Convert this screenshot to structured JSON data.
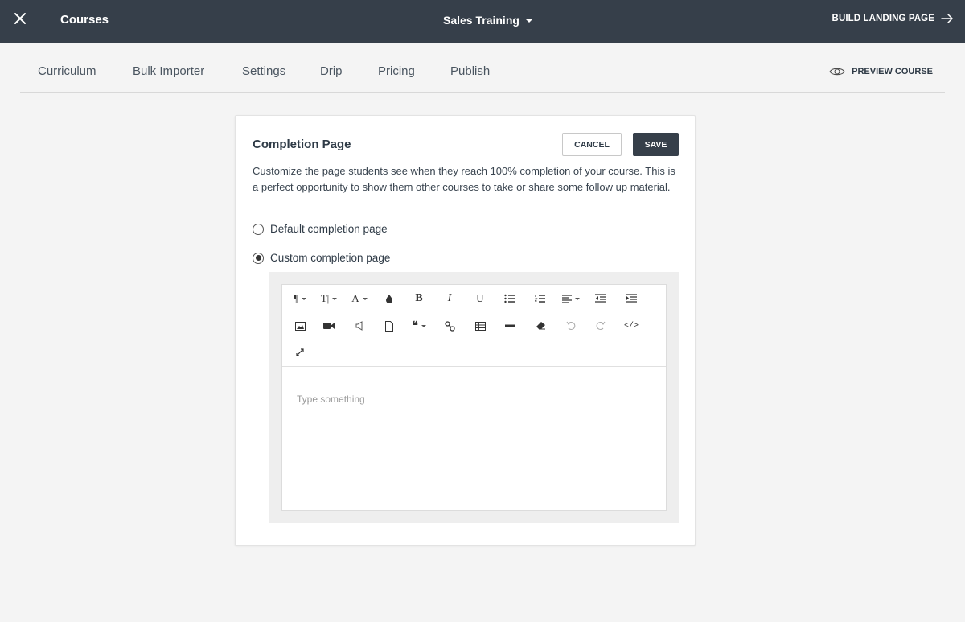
{
  "topbar": {
    "title": "Courses",
    "course_name": "Sales Training",
    "build_label": "BUILD LANDING PAGE"
  },
  "tabs": [
    {
      "label": "Curriculum"
    },
    {
      "label": "Bulk Importer"
    },
    {
      "label": "Settings"
    },
    {
      "label": "Drip"
    },
    {
      "label": "Pricing"
    },
    {
      "label": "Publish"
    }
  ],
  "preview_label": "PREVIEW COURSE",
  "card": {
    "heading": "Completion Page",
    "cancel_label": "CANCEL",
    "save_label": "SAVE",
    "description": "Customize the page students see when they reach 100% completion of your course. This is a perfect opportunity to show them other courses to take or share some follow up material.",
    "options": [
      {
        "label": "Default completion page",
        "selected": false
      },
      {
        "label": "Custom completion page",
        "selected": true
      }
    ]
  },
  "editor": {
    "placeholder": "Type something",
    "toolbar_icons": [
      "paragraph-format-icon",
      "font-size-icon",
      "font-family-icon",
      "color-icon",
      "bold-icon",
      "italic-icon",
      "underline-icon",
      "bullet-list-icon",
      "numbered-list-icon",
      "align-icon",
      "outdent-icon",
      "indent-icon",
      "image-icon",
      "video-icon",
      "audio-icon",
      "file-icon",
      "quote-icon",
      "link-icon",
      "table-icon",
      "horizontal-line-icon",
      "clear-format-icon",
      "undo-icon",
      "redo-icon",
      "code-view-icon",
      "fullscreen-icon"
    ]
  },
  "colors": {
    "topbar_bg": "#363f4a",
    "page_bg": "#f4f4f4",
    "save_bg": "#363f4a"
  }
}
